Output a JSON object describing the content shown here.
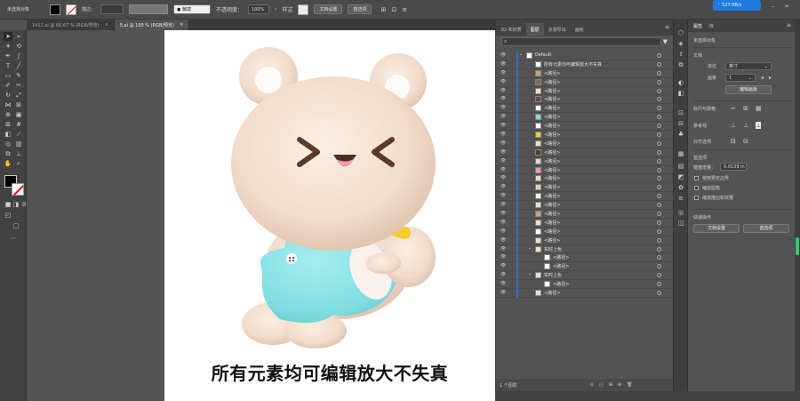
{
  "control_bar": {
    "selection": "未选择对象",
    "stroke_label": "描边：",
    "brush_label": "● 触摸",
    "opacity_label": "不透明度：",
    "opacity_value": "100%",
    "style_label": "样式",
    "doc_setup": "文档设置",
    "prefs": "首选项"
  },
  "network_badge": {
    "text": "527 KB/s",
    "arrow": "↓"
  },
  "tabs": [
    {
      "label": "1411.ai @ 66.67 % (RGB/预览)",
      "close": "×"
    },
    {
      "label": "5.ai @ 100 % (RGB/预览)",
      "close": "×"
    }
  ],
  "artboard": {
    "caption": "所有元素均可编辑放大不失真",
    "colors": {
      "body": "#f2dccb",
      "overall": "#7fdde0",
      "banana": "#f2cf2a",
      "face": "#5a3a2b",
      "tongue": "#f49aa2"
    }
  },
  "layers_panel": {
    "tabs": [
      "3D 和材质",
      "图层",
      "资源导出",
      "画板"
    ],
    "active_tab": "图层",
    "layers": [
      {
        "name": "Default",
        "depth": 0
      },
      {
        "name": "所有元素均可编辑放大不失真",
        "depth": 1
      },
      {
        "name": "<路径>",
        "depth": 1
      },
      {
        "name": "<路径>",
        "depth": 1
      },
      {
        "name": "<路径>",
        "depth": 1
      },
      {
        "name": "<路径>",
        "depth": 1
      },
      {
        "name": "<路径>",
        "depth": 1
      },
      {
        "name": "<路径>",
        "depth": 1
      },
      {
        "name": "<路径>",
        "depth": 1
      },
      {
        "name": "<路径>",
        "depth": 1
      },
      {
        "name": "<路径>",
        "depth": 1
      },
      {
        "name": "<路径>",
        "depth": 1
      },
      {
        "name": "<路径>",
        "depth": 1
      },
      {
        "name": "<路径>",
        "depth": 1
      },
      {
        "name": "<路径>",
        "depth": 1
      },
      {
        "name": "<路径>",
        "depth": 1
      },
      {
        "name": "<路径>",
        "depth": 1
      },
      {
        "name": "<路径>",
        "depth": 1
      },
      {
        "name": "<路径>",
        "depth": 1
      },
      {
        "name": "<路径>",
        "depth": 1
      },
      {
        "name": "<路径>",
        "depth": 1
      },
      {
        "name": "<路径>",
        "depth": 1
      },
      {
        "name": "实时上色",
        "depth": 1
      },
      {
        "name": "<路径>",
        "depth": 2
      },
      {
        "name": "<路径>",
        "depth": 2
      },
      {
        "name": "实时上色",
        "depth": 1
      },
      {
        "name": "<路径>",
        "depth": 2
      },
      {
        "name": "<路径>",
        "depth": 1
      }
    ],
    "footer": "1 个图层"
  },
  "properties": {
    "tabs": [
      "属性",
      "库"
    ],
    "selection": "未选择对象",
    "document": "文档",
    "unit_label": "单位",
    "unit_value": "英寸",
    "artboard_label": "画板",
    "artboard_value": "1",
    "edit_artboards": "编辑画板",
    "rulers_grid": "标尺与网格",
    "guides": "参考线",
    "align_options": "对齐选项",
    "prefs_section": "首选项",
    "keyboard_increment_label": "键盘增量：",
    "keyboard_increment_value": "0.0139 in",
    "chk_preview_bounds": "使用预览边界",
    "chk_scale_corners": "缩放圆角",
    "chk_scale_strokes": "缩放描边和效果",
    "quick_actions": "快速操作",
    "doc_setup": "文档设置",
    "prefs": "首选项"
  }
}
